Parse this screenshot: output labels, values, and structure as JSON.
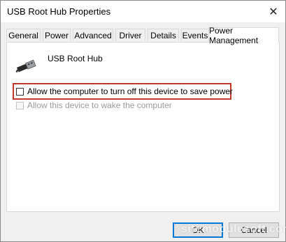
{
  "window": {
    "title": "USB Root Hub Properties",
    "close_glyph": "✕"
  },
  "tabs": [
    {
      "label": "General"
    },
    {
      "label": "Power"
    },
    {
      "label": "Advanced"
    },
    {
      "label": "Driver"
    },
    {
      "label": "Details"
    },
    {
      "label": "Events"
    },
    {
      "label": "Power Management",
      "active": true
    }
  ],
  "device": {
    "name": "USB Root Hub",
    "icon": "usb-connector-icon"
  },
  "options": [
    {
      "label": "Allow the computer to turn off this device to save power",
      "checked": false,
      "enabled": true
    },
    {
      "label": "Allow this device to wake the computer",
      "checked": false,
      "enabled": false
    }
  ],
  "buttons": {
    "ok": "OK",
    "cancel": "Cancel"
  },
  "watermark": "sitemodulesoft.com",
  "colors": {
    "highlight": "#c0392b",
    "default_button_border": "#0078d7"
  }
}
